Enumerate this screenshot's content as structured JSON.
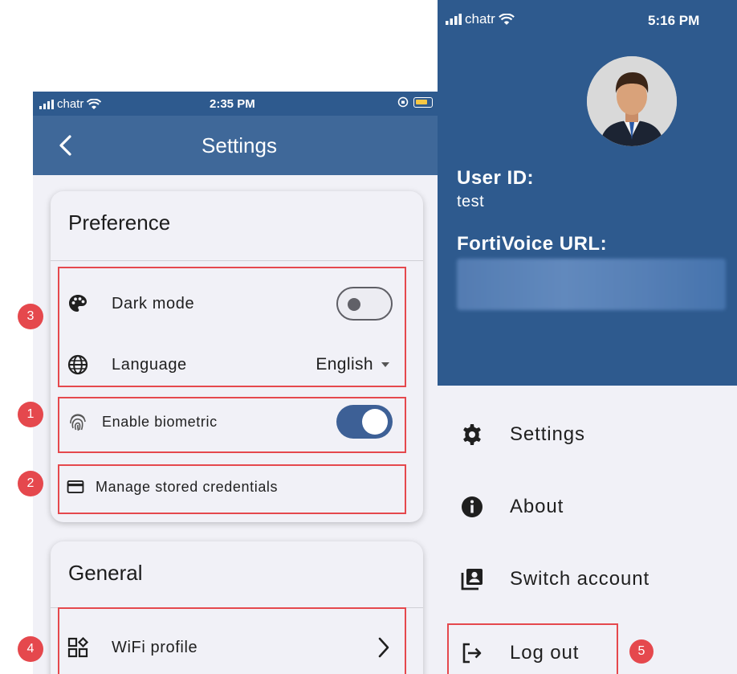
{
  "left_screen": {
    "status": {
      "carrier": "chatr",
      "time": "2:35 PM"
    },
    "appbar": {
      "title": "Settings"
    },
    "preference": {
      "title": "Preference",
      "dark_mode": {
        "label": "Dark mode",
        "enabled": false
      },
      "language": {
        "label": "Language",
        "value": "English"
      },
      "biometric": {
        "label": "Enable biometric",
        "enabled": true
      },
      "credentials": {
        "label": "Manage stored credentials"
      }
    },
    "general": {
      "title": "General",
      "wifi_profile": {
        "label": "WiFi profile"
      }
    }
  },
  "right_screen": {
    "status": {
      "carrier": "chatr",
      "time": "5:16 PM"
    },
    "user_id_label": "User ID:",
    "user_id_value": "test",
    "url_label": "FortiVoice URL:",
    "menu": {
      "settings": "Settings",
      "about": "About",
      "switch_account": "Switch account",
      "log_out": "Log out"
    }
  },
  "annotations": {
    "badge_1": "1",
    "badge_2": "2",
    "badge_3": "3",
    "badge_4": "4",
    "badge_5": "5"
  },
  "colors": {
    "header_dark": "#2e5a8e",
    "appbar": "#3f6899",
    "highlight": "#e5484d",
    "toggle_on": "#3d6096",
    "background": "#f1f1f7"
  }
}
